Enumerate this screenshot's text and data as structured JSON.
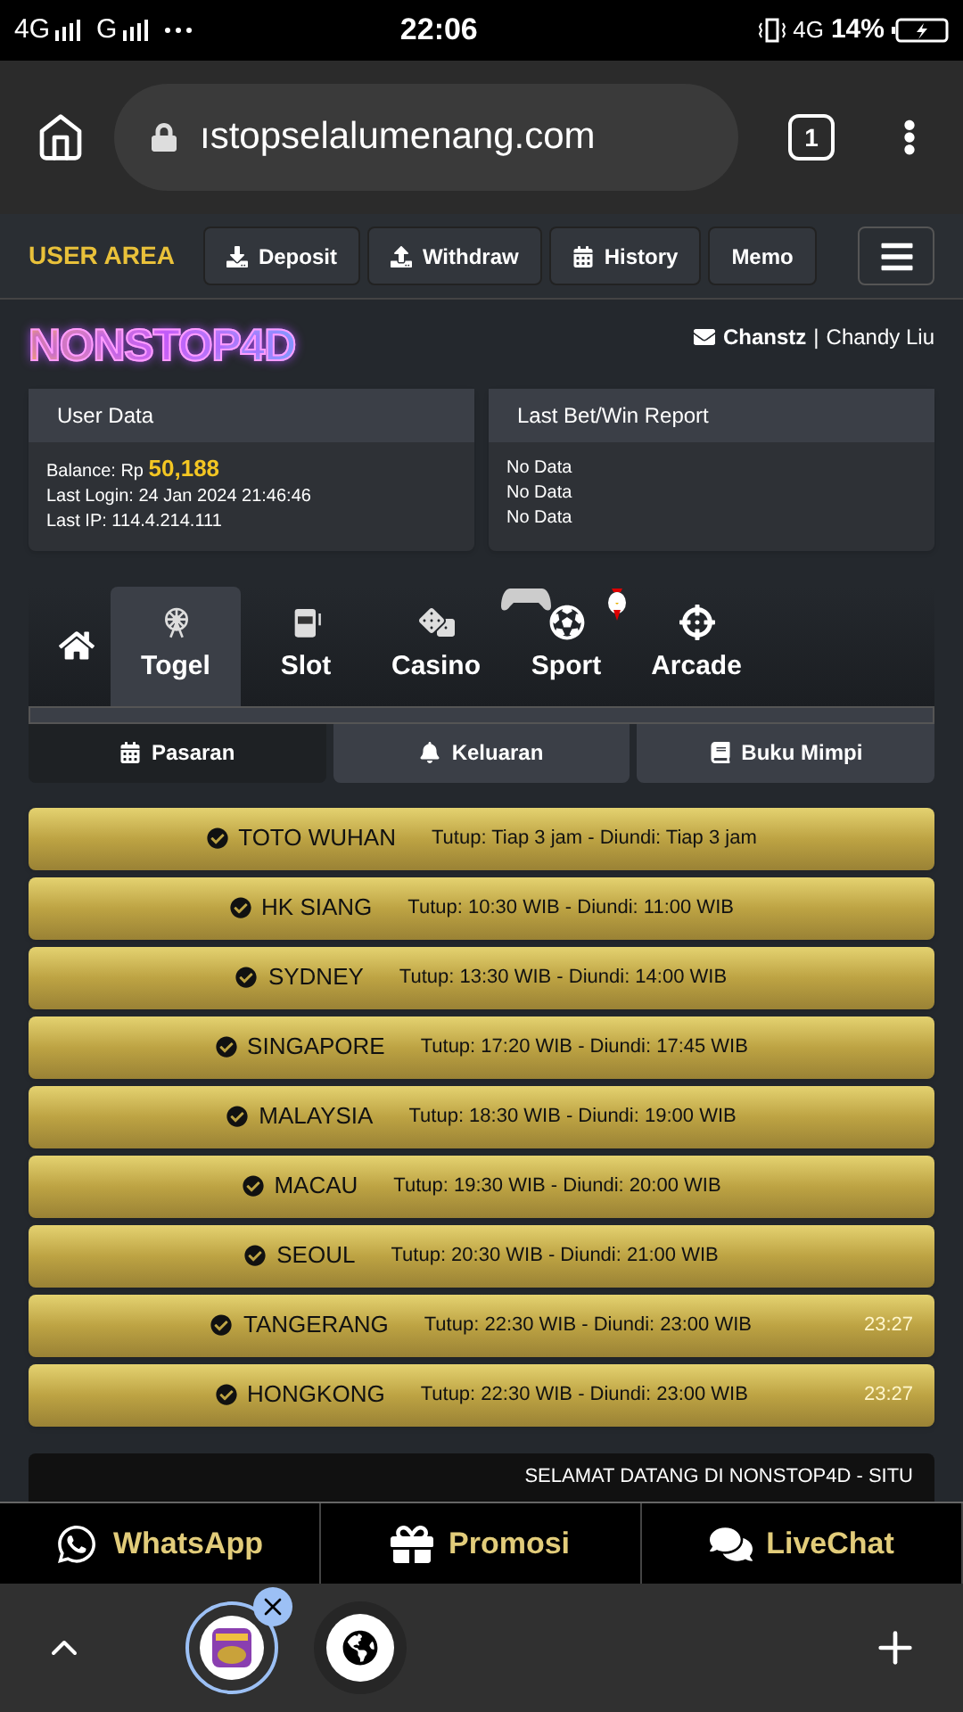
{
  "status_bar": {
    "network_1": "4G",
    "network_2": "G",
    "time": "22:06",
    "network_3": "4G",
    "battery": "14%"
  },
  "browser": {
    "url": "ıstopselalumenang.com",
    "tab_count": "1"
  },
  "user_area": {
    "title": "USER AREA",
    "buttons": [
      {
        "label": "Deposit",
        "kind": "deposit"
      },
      {
        "label": "Withdraw",
        "kind": "withdraw"
      },
      {
        "label": "History",
        "kind": "history"
      },
      {
        "label": "Memo",
        "kind": "plain"
      }
    ]
  },
  "logo": "NONSTOP4D",
  "user": {
    "username": "Chanstz",
    "separator": "|",
    "name": "Chandy Liu"
  },
  "user_data": {
    "title": "User Data",
    "balance_label": "Balance: Rp",
    "balance": "50,188",
    "lines": [
      "Last Login: 24 Jan 2024 21:46:46",
      "Last IP: 114.4.214.111"
    ]
  },
  "report": {
    "title": "Last Bet/Win Report",
    "lines": [
      "No Data",
      "No Data",
      "No Data"
    ]
  },
  "categories": [
    {
      "kind": "home",
      "selected": false
    },
    {
      "label": "Togel",
      "kind": "togel",
      "selected": true
    },
    {
      "label": "Slot",
      "kind": "slot",
      "selected": false
    },
    {
      "label": "Casino",
      "kind": "casino",
      "selected": false
    },
    {
      "label": "Sport",
      "kind": "sport",
      "selected": false
    },
    {
      "label": "Arcade",
      "kind": "arcade",
      "selected": false
    }
  ],
  "sub_tabs": [
    {
      "label": "Pasaran",
      "kind": "calendar",
      "selected": true
    },
    {
      "label": "Keluaran",
      "kind": "bell",
      "selected": false
    },
    {
      "label": "Buku Mimpi",
      "kind": "book",
      "selected": false
    }
  ],
  "markets": [
    {
      "name": "TOTO WUHAN",
      "schedule": "Tutup: Tiap 3 jam - Diundi: Tiap 3 jam"
    },
    {
      "name": "HK SIANG",
      "schedule": "Tutup: 10:30 WIB - Diundi: 11:00 WIB"
    },
    {
      "name": "SYDNEY",
      "schedule": "Tutup: 13:30 WIB - Diundi: 14:00 WIB"
    },
    {
      "name": "SINGAPORE",
      "schedule": "Tutup: 17:20 WIB - Diundi: 17:45 WIB"
    },
    {
      "name": "MALAYSIA",
      "schedule": "Tutup: 18:30 WIB - Diundi: 19:00 WIB"
    },
    {
      "name": "MACAU",
      "schedule": "Tutup: 19:30 WIB - Diundi: 20:00 WIB"
    },
    {
      "name": "SEOUL",
      "schedule": "Tutup: 20:30 WIB - Diundi: 21:00 WIB"
    },
    {
      "name": "TANGERANG",
      "schedule": "Tutup: 22:30 WIB - Diundi: 23:00 WIB",
      "countdown": "23:27"
    },
    {
      "name": "HONGKONG",
      "schedule": "Tutup: 22:30 WIB - Diundi: 23:00 WIB",
      "countdown": "23:27"
    }
  ],
  "marquee": "SELAMAT DATANG DI NONSTOP4D - SITU",
  "bottom_links": [
    {
      "label": "WhatsApp",
      "kind": "whatsapp"
    },
    {
      "label": "Promosi",
      "kind": "gift"
    },
    {
      "label": "LiveChat",
      "kind": "chat"
    }
  ]
}
